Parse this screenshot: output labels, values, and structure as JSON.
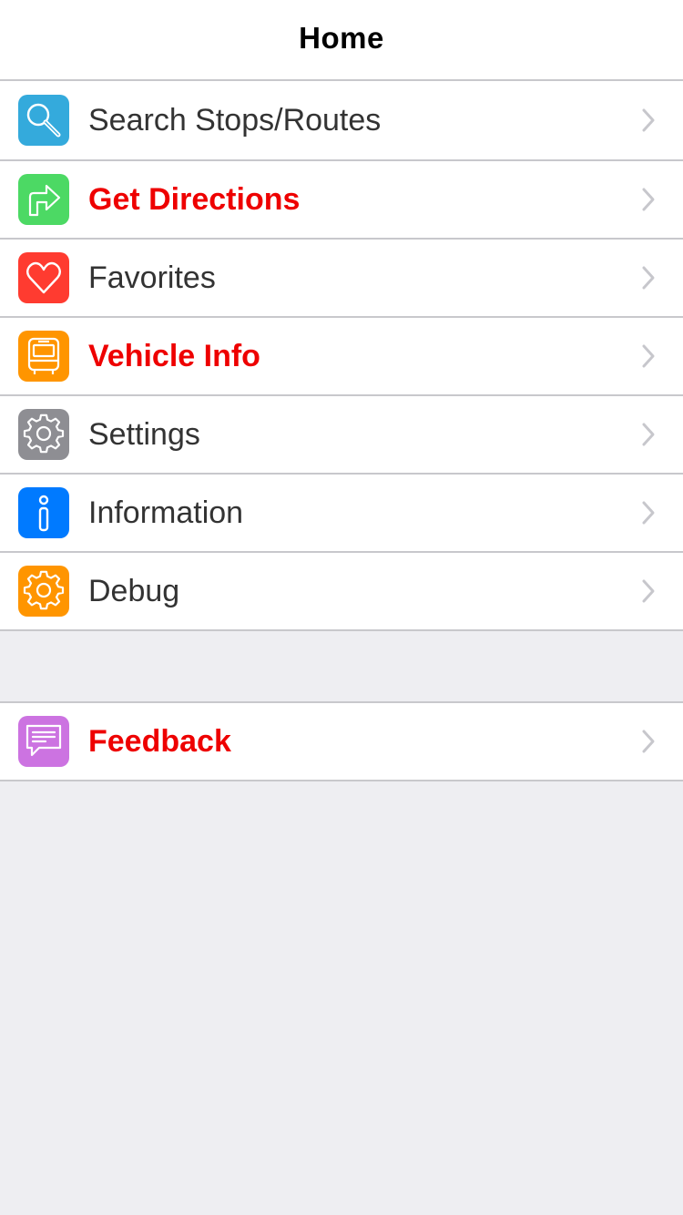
{
  "navbar": {
    "title": "Home"
  },
  "menu": {
    "items": [
      {
        "label": "Search Stops/Routes",
        "icon": "search-icon",
        "color": "#34aadc",
        "highlight": false
      },
      {
        "label": "Get Directions",
        "icon": "directions-arrow-icon",
        "color": "#4cd964",
        "highlight": true
      },
      {
        "label": "Favorites",
        "icon": "heart-icon",
        "color": "#ff3b30",
        "highlight": false
      },
      {
        "label": "Vehicle Info",
        "icon": "bus-icon",
        "color": "#ff9500",
        "highlight": true
      },
      {
        "label": "Settings",
        "icon": "gear-icon",
        "color": "#8e8e93",
        "highlight": false
      },
      {
        "label": "Information",
        "icon": "info-icon",
        "color": "#007aff",
        "highlight": false
      },
      {
        "label": "Debug",
        "icon": "gear-icon",
        "color": "#ff9500",
        "highlight": false
      }
    ]
  },
  "secondary": {
    "items": [
      {
        "label": "Feedback",
        "icon": "chat-bubble-icon",
        "color": "#cc73e1",
        "highlight": true
      }
    ]
  },
  "colors": {
    "highlight_text": "#ee0000",
    "normal_text": "#333333",
    "separator": "#c8c8cc",
    "background": "#eeeef2",
    "chevron": "#c7c7cc"
  }
}
